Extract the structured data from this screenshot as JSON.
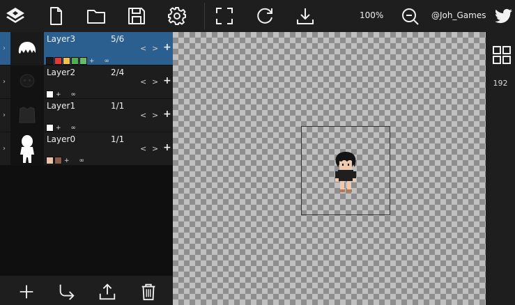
{
  "toolbar": {
    "zoom": "100%",
    "handle": "@Joh_Games"
  },
  "layers": [
    {
      "name": "Layer3",
      "frames": "5/6",
      "selected": true,
      "palette": [
        "#1a1a1a",
        "#e53935",
        "#f0c24b",
        "#4caf50",
        "#66bb6a"
      ]
    },
    {
      "name": "Layer2",
      "frames": "2/4",
      "selected": false,
      "palette": [
        "#ffffff"
      ]
    },
    {
      "name": "Layer1",
      "frames": "1/1",
      "selected": false,
      "palette": [
        "#ffffff"
      ]
    },
    {
      "name": "Layer0",
      "frames": "1/1",
      "selected": false,
      "palette": [
        "#e8c4a8",
        "#8a5a48"
      ]
    }
  ],
  "right_panel": {
    "size": "192"
  },
  "colors": {
    "selected_row": "#2a5f8f",
    "toolbar_bg": "#1e1e1e"
  },
  "icons": {
    "toolbar": [
      "app-logo-icon",
      "new-file-icon",
      "folder-icon",
      "save-icon",
      "settings-icon",
      "fullscreen-icon",
      "refresh-icon",
      "download-icon",
      "zoom-out-icon",
      "twitter-icon"
    ],
    "bottom": [
      "add-icon",
      "merge-icon",
      "export-icon",
      "trash-icon"
    ]
  }
}
